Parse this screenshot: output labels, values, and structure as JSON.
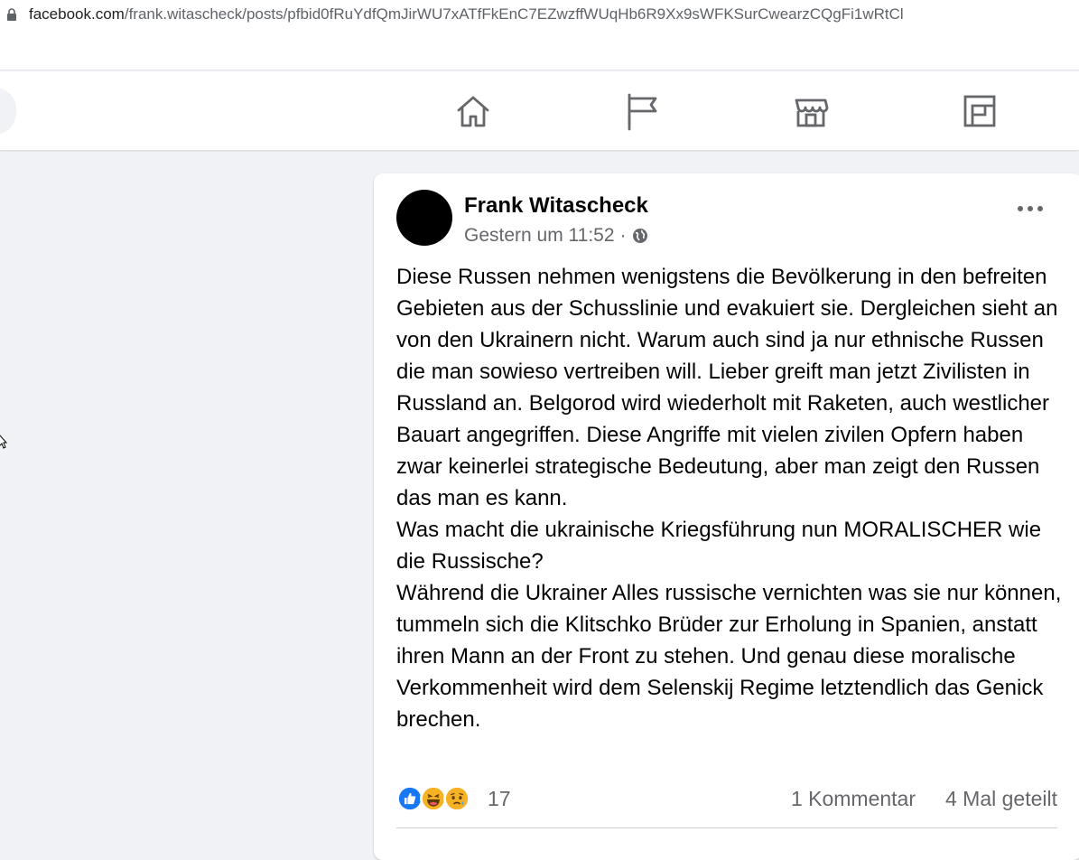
{
  "browser": {
    "url_domain": "facebook.com",
    "url_path": "/frank.witascheck/posts/pfbid0fRuYdfQmJirWU7xATfFkEnC7EZwzffWUqHb6R9Xx9sWFKSurCwearzCQgFi1wRtCl"
  },
  "nav": {
    "icons": [
      "home-icon",
      "pages-flag-icon",
      "marketplace-icon",
      "gaming-icon"
    ]
  },
  "post": {
    "author": "Frank Witascheck",
    "timestamp": "Gestern um 11:52",
    "separator": "·",
    "paragraphs": [
      "Diese Russen nehmen wenigstens die Bevölkerung in den befreiten Gebieten aus der Schusslinie und evakuiert sie. Dergleichen sieht an von den Ukrainern nicht. Warum auch sind ja nur ethnische Russen die man sowieso vertreiben will. Lieber greift man jetzt Zivilisten in Russland an. Belgorod wird wiederholt mit Raketen, auch westlicher Bauart angegriffen. Diese Angriffe mit vielen zivilen Opfern haben zwar keinerlei strategische Bedeutung, aber man zeigt den Russen das man es kann.",
      "Was macht die ukrainische Kriegsführung nun MORALISCHER wie die Russische?",
      "Während die Ukrainer Alles russische vernichten was sie nur können, tummeln sich die Klitschko Brüder zur Erholung in Spanien, anstatt ihren Mann an der Front zu stehen. Und genau diese moralische Verkommenheit wird dem Selenskij Regime letztendlich das Genick brechen."
    ],
    "reaction_count": "17",
    "comments": "1 Kommentar",
    "shares": "4 Mal geteilt",
    "colors": {
      "like": "#1877f2",
      "haha": "#f7b125",
      "sad": "#f7b125"
    }
  }
}
